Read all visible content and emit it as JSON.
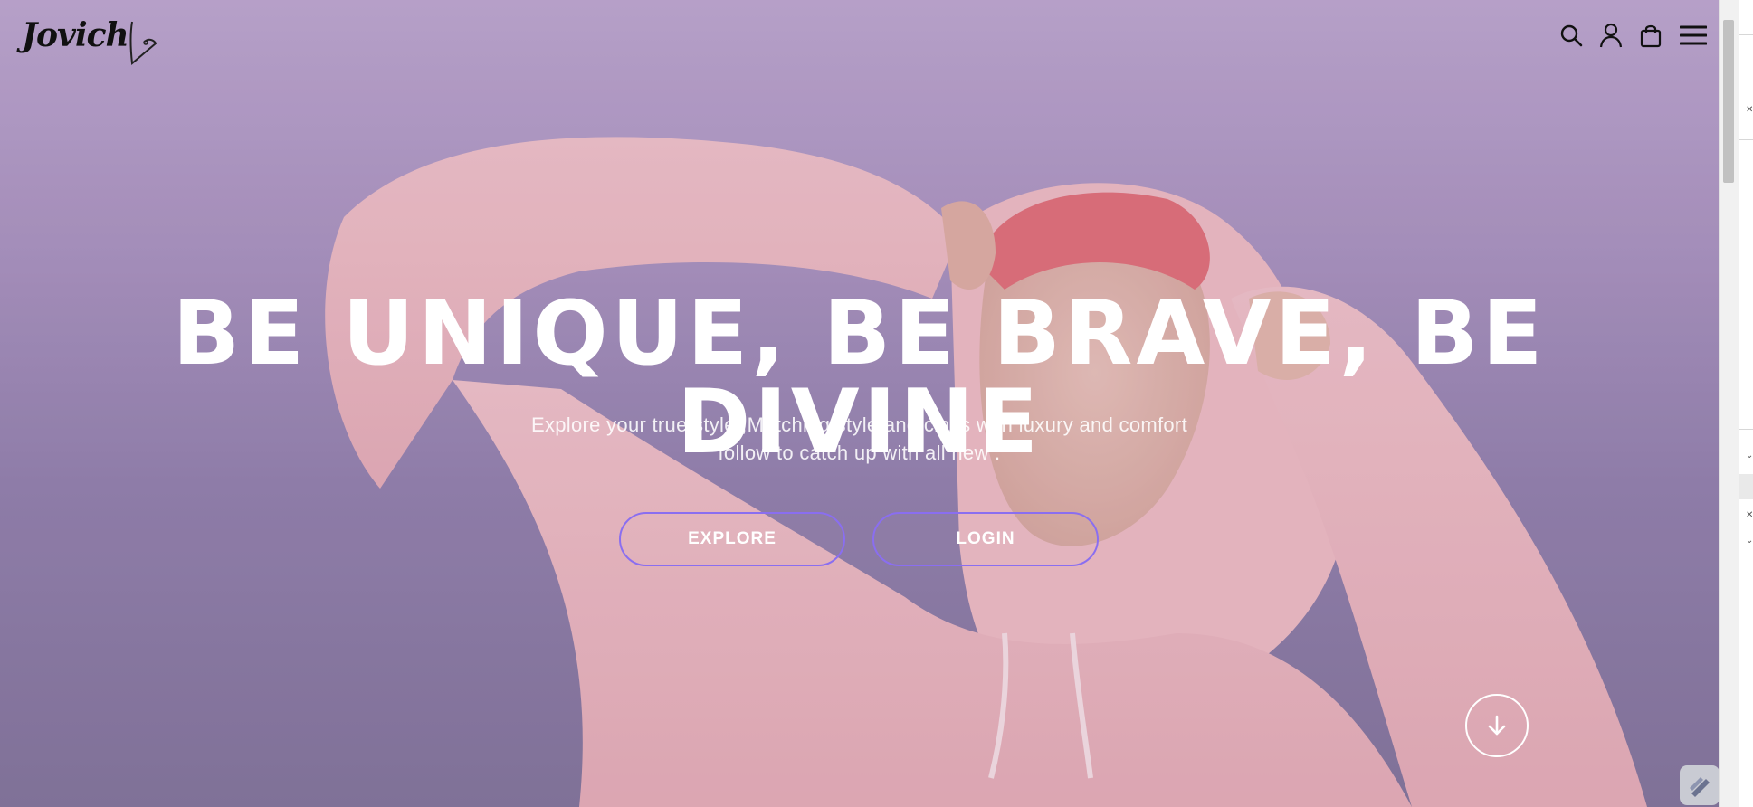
{
  "header": {
    "logo_text": "Jovich",
    "icons": [
      "search-icon",
      "user-icon",
      "shopping-bag-icon",
      "menu-icon"
    ]
  },
  "hero": {
    "title": "BE UNIQUE, BE BRAVE, BE DIVINE",
    "subtitle_line1": "Explore your true style ,Matching style and class with luxury and comfort",
    "subtitle_line2": "follow to catch up with all new .",
    "explore_label": "EXPLORE",
    "login_label": "LOGIN",
    "scroll_icon": "arrow-down-icon"
  },
  "colors": {
    "button_border": "#8a6ef0",
    "hero_bg_top": "#bca6cd",
    "hero_bg_bottom": "#7e7196",
    "text": "#ffffff"
  }
}
